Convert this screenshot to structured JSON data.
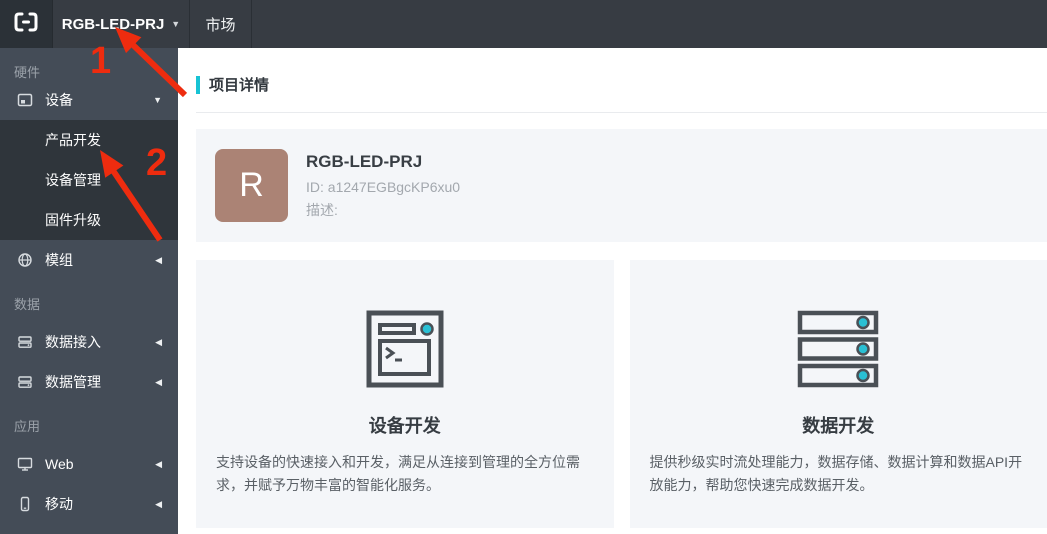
{
  "topbar": {
    "project_selector": {
      "label": "RGB-LED-PRJ"
    },
    "market_label": "市场"
  },
  "sidebar": {
    "sections": [
      {
        "label": "硬件",
        "items": [
          {
            "label": "设备",
            "icon": "device-icon",
            "expanded": true,
            "children": [
              "产品开发",
              "设备管理",
              "固件升级"
            ]
          },
          {
            "label": "模组",
            "icon": "module-icon",
            "expanded": false
          }
        ]
      },
      {
        "label": "数据",
        "items": [
          {
            "label": "数据接入",
            "icon": "database-icon",
            "expanded": false
          },
          {
            "label": "数据管理",
            "icon": "database-icon",
            "expanded": false
          }
        ]
      },
      {
        "label": "应用",
        "items": [
          {
            "label": "Web",
            "icon": "web-monitor-icon",
            "expanded": false
          },
          {
            "label": "移动",
            "icon": "mobile-icon",
            "expanded": false
          }
        ]
      }
    ]
  },
  "main": {
    "page_title": "项目详情",
    "project": {
      "avatar_letter": "R",
      "name": "RGB-LED-PRJ",
      "id_text": "ID: a1247EGBgcKP6xu0",
      "desc_text": "描述:"
    },
    "cards": [
      {
        "title": "设备开发",
        "icon": "terminal-icon",
        "description": "支持设备的快速接入和开发，满足从连接到管理的全方位需求，并赋予万物丰富的智能化服务。"
      },
      {
        "title": "数据开发",
        "icon": "server-stack-icon",
        "description": "提供秒级实时流处理能力，数据存储、数据计算和数据API开放能力，帮助您快速完成数据开发。"
      }
    ]
  },
  "annotations": [
    {
      "number": "1"
    },
    {
      "number": "2"
    }
  ],
  "colors": {
    "topbar_bg": "#373c43",
    "logo_bg": "#2b3137",
    "sidebar_bg": "#444c57",
    "submenu_bg": "#2f353b",
    "accent_cyan": "#17c3d4",
    "icon_teal": "#2ac0d4",
    "card_bg": "#f4f6f9",
    "avatar_bg": "#ab8375",
    "annotation_red": "#ee2c0f"
  }
}
